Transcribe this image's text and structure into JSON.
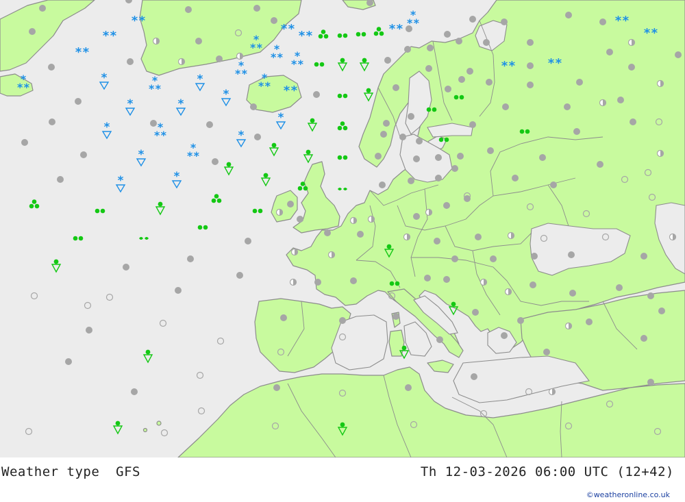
{
  "map": {
    "product_label": "Weather type",
    "model": "GFS",
    "valid_time": "Th 12-03-2026 06:00 UTC (12+42)",
    "credit": "©weatheronline.co.uk"
  },
  "colors": {
    "sea": "#ececec",
    "land": "#c8fa9e",
    "coast": "#8c8c8c",
    "snow": "#1e90e6",
    "rain": "#14c814",
    "cloud": "#a6a6a6"
  },
  "symbol_types": [
    "overcast",
    "partly-cloudy",
    "clear",
    "snow",
    "heavy-snow",
    "snow-shower",
    "rain",
    "heavy-rain",
    "drizzle",
    "rain-shower"
  ]
}
